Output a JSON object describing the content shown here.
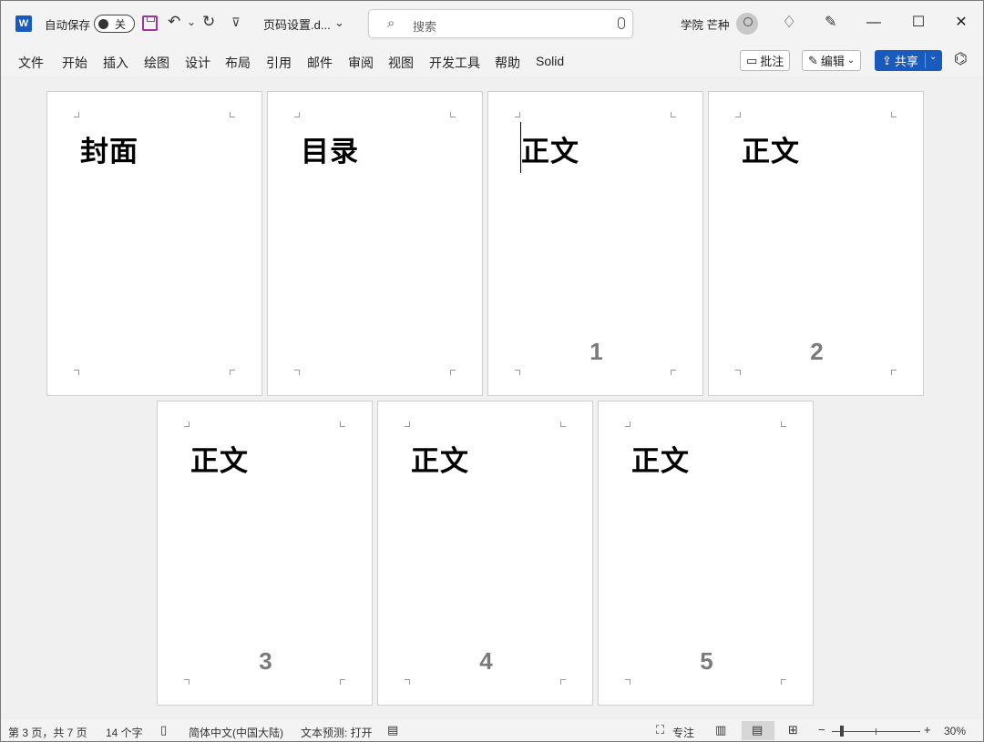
{
  "titlebar": {
    "app_icon": "W",
    "autosave_label": "自动保存",
    "autosave_state": "关",
    "undo_glyph": "↶",
    "undo_dropdown": "⌄",
    "redo_glyph": "↻",
    "customize_glyph": "⊽",
    "doc_title": "页码设置.d...",
    "doc_title_chevron": "⌄",
    "search_placeholder": "搜索",
    "user_name": "学院 芒种",
    "minimize": "—",
    "maximize": "☐",
    "close": "✕"
  },
  "ribbon": {
    "tabs": [
      "文件",
      "开始",
      "插入",
      "绘图",
      "设计",
      "布局",
      "引用",
      "邮件",
      "审阅",
      "视图",
      "开发工具",
      "帮助",
      "Solid"
    ],
    "comment_label": "批注",
    "edit_label": "编辑",
    "share_label": "共享"
  },
  "pages": [
    {
      "heading": "封面",
      "number": ""
    },
    {
      "heading": "目录",
      "number": ""
    },
    {
      "heading": "正文",
      "number": "1"
    },
    {
      "heading": "正文",
      "number": "2"
    },
    {
      "heading": "正文",
      "number": "3"
    },
    {
      "heading": "正文",
      "number": "4"
    },
    {
      "heading": "正文",
      "number": "5"
    }
  ],
  "statusbar": {
    "page_info": "第 3 页，共 7 页",
    "word_count": "14 个字",
    "language": "简体中文(中国大陆)",
    "text_prediction": "文本预测: 打开",
    "focus_label": "专注",
    "zoom_minus": "−",
    "zoom_plus": "+",
    "zoom_percent": "30%",
    "zoom_level": 30
  },
  "colors": {
    "accent": "#185abd",
    "save_icon": "#a0339c",
    "page_number": "#7a7a7a"
  }
}
